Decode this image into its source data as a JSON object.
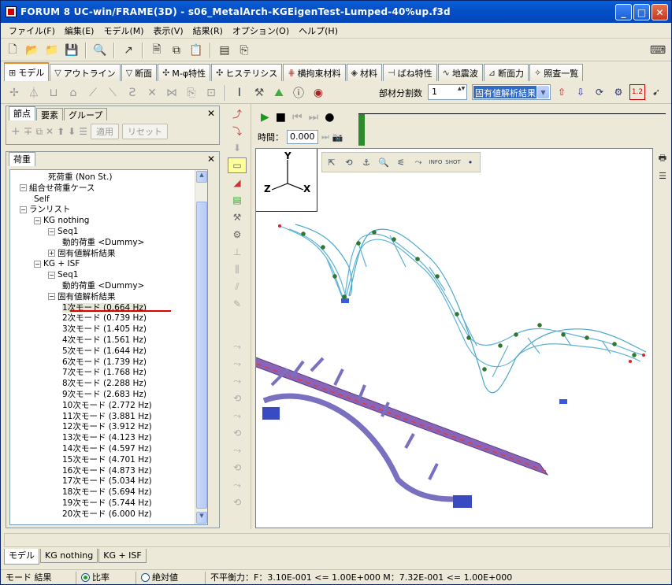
{
  "window": {
    "title": "FORUM 8  UC-win/FRAME(3D) - s06_MetalArch-KGEigenTest-Lumped-40%up.f3d"
  },
  "menu": [
    "ファイル(F)",
    "編集(E)",
    "モデル(M)",
    "表示(V)",
    "結果(R)",
    "オプション(O)",
    "ヘルプ(H)"
  ],
  "main_tabs": [
    "モデル",
    "アウトライン",
    "断面",
    "M-φ特性",
    "ヒステリシス",
    "横拘束材料",
    "材料",
    "ばね特性",
    "地震波",
    "断面力",
    "照査一覧"
  ],
  "toolbar2": {
    "division_label": "部材分割数",
    "division_value": "1",
    "result_select": "固有値解析結果"
  },
  "panel1": {
    "tabs": [
      "節点",
      "要素",
      "グループ"
    ],
    "apply": "適用",
    "reset": "リセット"
  },
  "panel2": {
    "tab": "荷重"
  },
  "tree": {
    "items": [
      {
        "label": "死荷重 (Non St.)",
        "level": 3,
        "toggle": ""
      },
      {
        "label": "組合せ荷重ケース",
        "level": 1,
        "toggle": "−"
      },
      {
        "label": "Self",
        "level": 2,
        "toggle": ""
      },
      {
        "label": "ランリスト",
        "level": 1,
        "toggle": "−"
      },
      {
        "label": "KG nothing",
        "level": 2,
        "toggle": "−"
      },
      {
        "label": "Seq1",
        "level": 3,
        "toggle": "−"
      },
      {
        "label": "動的荷重 <Dummy>",
        "level": 4,
        "toggle": ""
      },
      {
        "label": "固有値解析結果",
        "level": 3,
        "toggle": "+"
      },
      {
        "label": "KG + ISF",
        "level": 2,
        "toggle": "−"
      },
      {
        "label": "Seq1",
        "level": 3,
        "toggle": "−"
      },
      {
        "label": "動的荷重 <Dummy>",
        "level": 4,
        "toggle": ""
      },
      {
        "label": "固有値解析結果",
        "level": 3,
        "toggle": "−"
      },
      {
        "label": "1次モード (0.664 Hz)",
        "level": 4,
        "toggle": ""
      },
      {
        "label": "2次モード (0.739 Hz)",
        "level": 4,
        "toggle": ""
      },
      {
        "label": "3次モード (1.405 Hz)",
        "level": 4,
        "toggle": ""
      },
      {
        "label": "4次モード (1.561 Hz)",
        "level": 4,
        "toggle": ""
      },
      {
        "label": "5次モード (1.644 Hz)",
        "level": 4,
        "toggle": ""
      },
      {
        "label": "6次モード (1.739 Hz)",
        "level": 4,
        "toggle": ""
      },
      {
        "label": "7次モード (1.768 Hz)",
        "level": 4,
        "toggle": ""
      },
      {
        "label": "8次モード (2.288 Hz)",
        "level": 4,
        "toggle": ""
      },
      {
        "label": "9次モード (2.683 Hz)",
        "level": 4,
        "toggle": ""
      },
      {
        "label": "10次モード (2.772 Hz)",
        "level": 4,
        "toggle": ""
      },
      {
        "label": "11次モード (3.881 Hz)",
        "level": 4,
        "toggle": ""
      },
      {
        "label": "12次モード (3.912 Hz)",
        "level": 4,
        "toggle": ""
      },
      {
        "label": "13次モード (4.123 Hz)",
        "level": 4,
        "toggle": ""
      },
      {
        "label": "14次モード (4.597 Hz)",
        "level": 4,
        "toggle": ""
      },
      {
        "label": "15次モード (4.701 Hz)",
        "level": 4,
        "toggle": ""
      },
      {
        "label": "16次モード (4.873 Hz)",
        "level": 4,
        "toggle": ""
      },
      {
        "label": "17次モード (5.034 Hz)",
        "level": 4,
        "toggle": ""
      },
      {
        "label": "18次モード (5.694 Hz)",
        "level": 4,
        "toggle": ""
      },
      {
        "label": "19次モード (5.744 Hz)",
        "level": 4,
        "toggle": ""
      },
      {
        "label": "20次モード (6.000 Hz)",
        "level": 4,
        "toggle": ""
      }
    ],
    "selected_index": 12
  },
  "animation": {
    "time_label": "時間：",
    "time_value": "0.000"
  },
  "axes": {
    "y": "Y",
    "z": "Z",
    "x": "X"
  },
  "bottom_tabs": [
    "モデル",
    "KG nothing",
    "KG + ISF"
  ],
  "status": {
    "mode": "モード 結果",
    "ratio": "比率",
    "absolute": "絶対値",
    "balance": "不平衡力：F：3.10E-001 <= 1.00E+000 M：7.32E-001 <= 1.00E+000"
  }
}
